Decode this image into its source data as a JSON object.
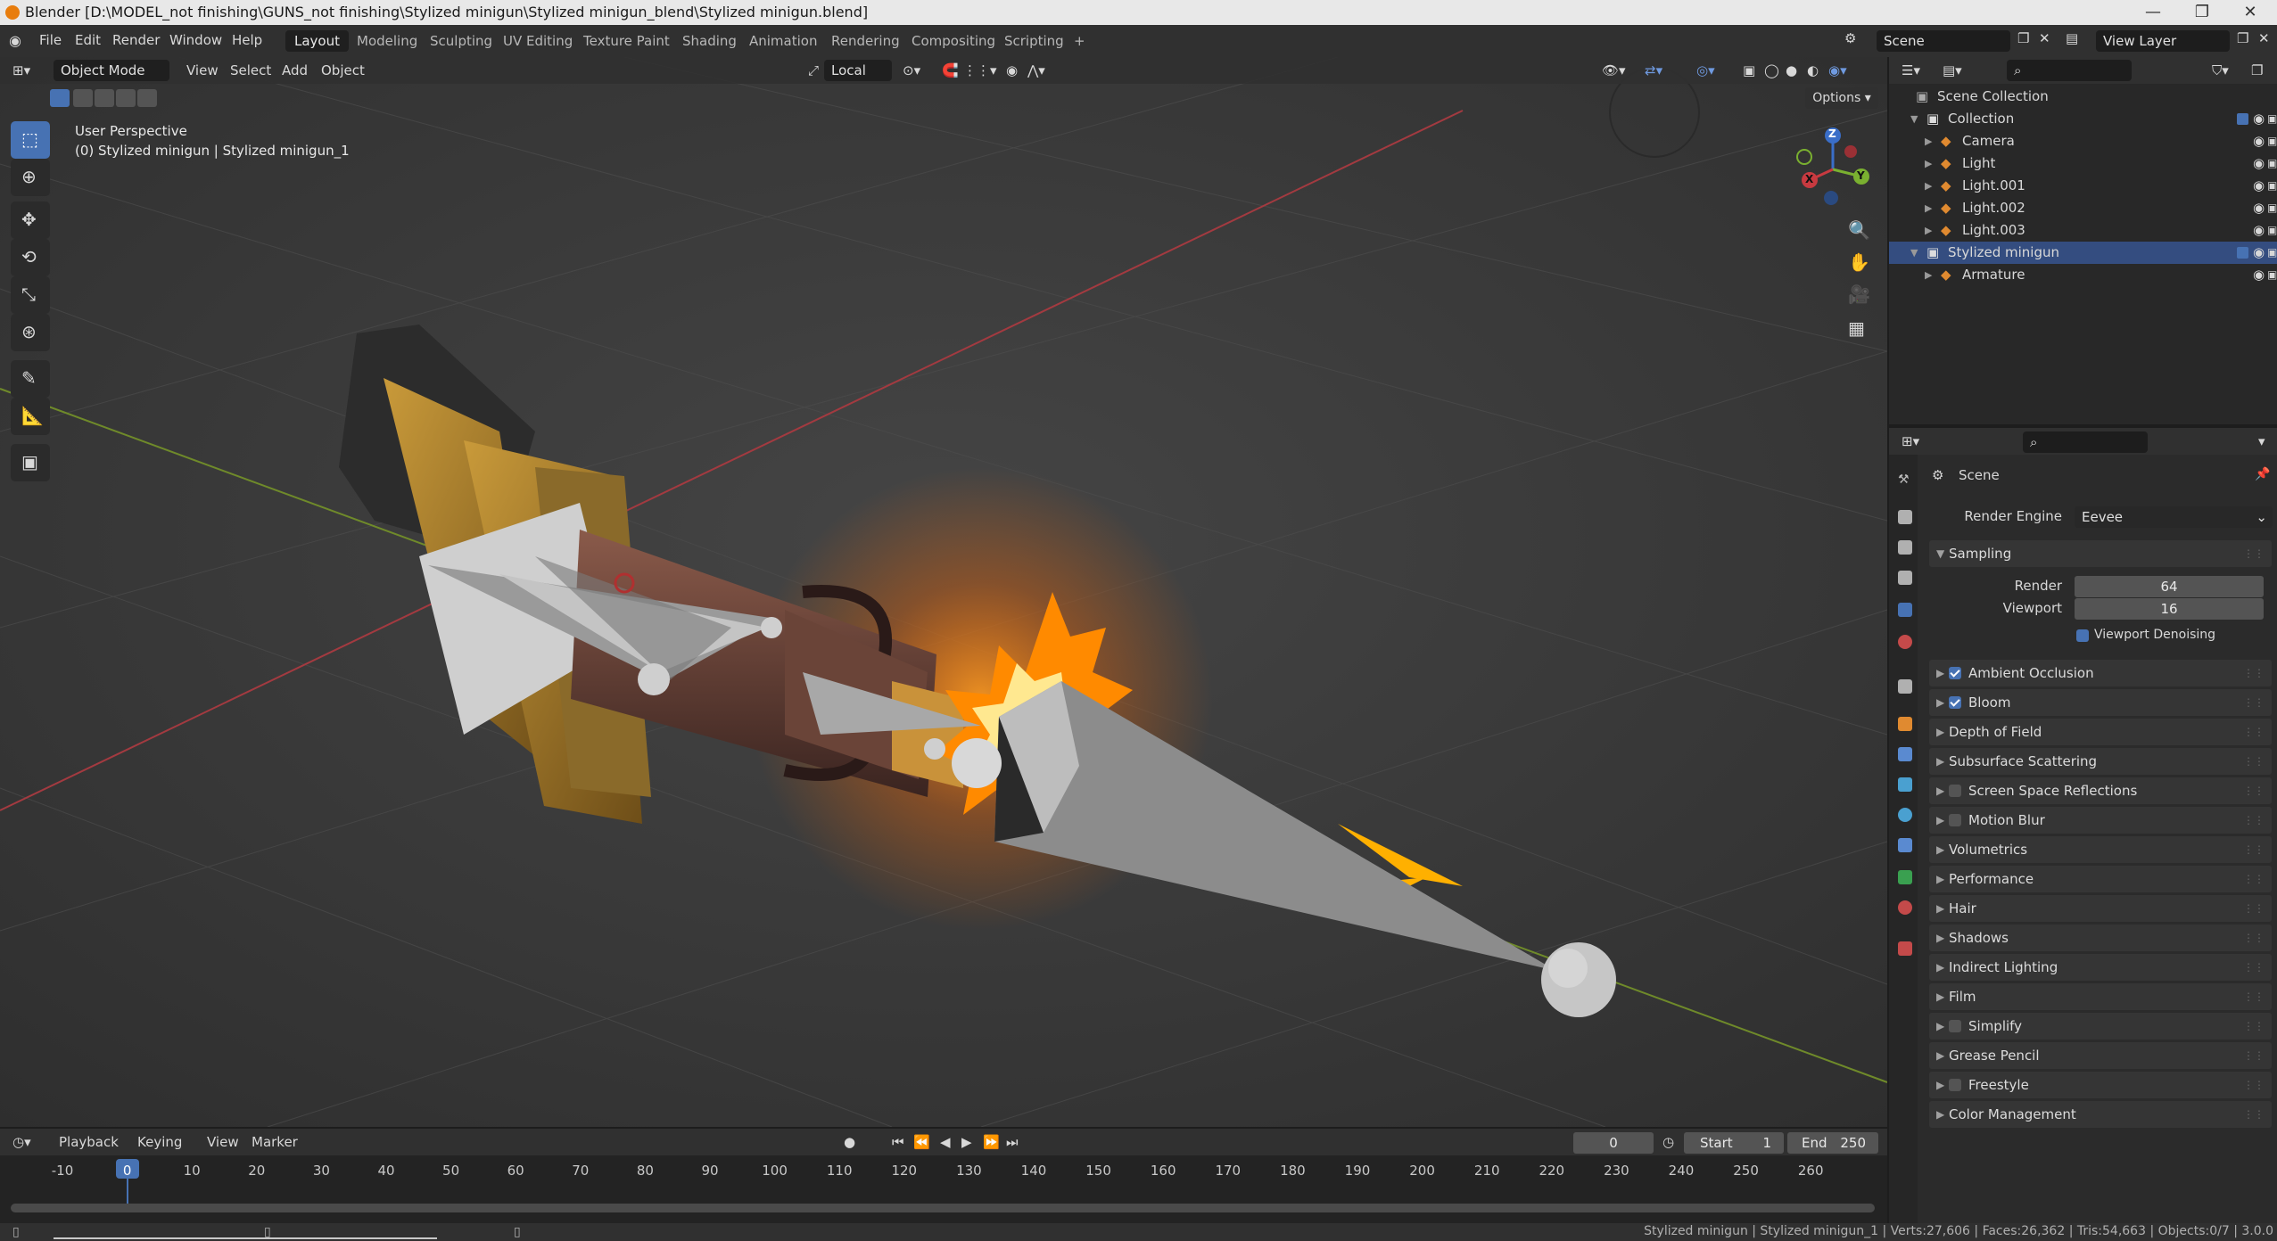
{
  "window": {
    "title": "Blender [D:\\MODEL_not finishing\\GUNS_not finishing\\Stylized minigun\\Stylized minigun_blend\\Stylized minigun.blend]"
  },
  "menus": [
    "File",
    "Edit",
    "Render",
    "Window",
    "Help"
  ],
  "workspaces": [
    "Layout",
    "Modeling",
    "Sculpting",
    "UV Editing",
    "Texture Paint",
    "Shading",
    "Animation",
    "Rendering",
    "Compositing",
    "Scripting",
    "+"
  ],
  "scene": {
    "name": "Scene",
    "view_layer": "View Layer"
  },
  "viewport_header": {
    "mode": "Object Mode",
    "menus": [
      "View",
      "Select",
      "Add",
      "Object"
    ],
    "transform_orientation": "Local",
    "options_label": "Options"
  },
  "viewport_overlay": {
    "perspective": "User Perspective",
    "object_info": "(0) Stylized minigun | Stylized minigun_1"
  },
  "gizmo": {
    "x": "X",
    "y": "Y",
    "z": "Z"
  },
  "outliner": {
    "root": "Scene Collection",
    "rows": [
      {
        "label": "Collection",
        "level": 0,
        "type": "collection"
      },
      {
        "label": "Camera",
        "level": 1,
        "type": "object"
      },
      {
        "label": "Light",
        "level": 1,
        "type": "object"
      },
      {
        "label": "Light.001",
        "level": 1,
        "type": "object"
      },
      {
        "label": "Light.002",
        "level": 1,
        "type": "object"
      },
      {
        "label": "Light.003",
        "level": 1,
        "type": "object"
      },
      {
        "label": "Stylized minigun",
        "level": 0,
        "type": "collection",
        "selected": true
      },
      {
        "label": "Armature",
        "level": 1,
        "type": "object"
      }
    ]
  },
  "properties": {
    "context": "Scene",
    "render_engine_label": "Render Engine",
    "render_engine": "Eevee",
    "sampling": {
      "label": "Sampling",
      "render_label": "Render",
      "render": "64",
      "viewport_label": "Viewport",
      "viewport": "16",
      "denoise_label": "Viewport Denoising"
    },
    "panels": [
      {
        "label": "Ambient Occlusion",
        "checkbox": true,
        "checked": true
      },
      {
        "label": "Bloom",
        "checkbox": true,
        "checked": true
      },
      {
        "label": "Depth of Field",
        "checkbox": false
      },
      {
        "label": "Subsurface Scattering",
        "checkbox": false
      },
      {
        "label": "Screen Space Reflections",
        "checkbox": true,
        "checked": false
      },
      {
        "label": "Motion Blur",
        "checkbox": true,
        "checked": false
      },
      {
        "label": "Volumetrics",
        "checkbox": false
      },
      {
        "label": "Performance",
        "checkbox": false
      },
      {
        "label": "Hair",
        "checkbox": false
      },
      {
        "label": "Shadows",
        "checkbox": false
      },
      {
        "label": "Indirect Lighting",
        "checkbox": false
      },
      {
        "label": "Film",
        "checkbox": false
      },
      {
        "label": "Simplify",
        "checkbox": true,
        "checked": false
      },
      {
        "label": "Grease Pencil",
        "checkbox": false
      },
      {
        "label": "Freestyle",
        "checkbox": true,
        "checked": false
      },
      {
        "label": "Color Management",
        "checkbox": false
      }
    ]
  },
  "timeline": {
    "menus": [
      "Playback",
      "Keying",
      "View",
      "Marker"
    ],
    "current_frame": "0",
    "start_label": "Start",
    "start": "1",
    "end_label": "End",
    "end": "250",
    "ticks": [
      "-10",
      "0",
      "10",
      "20",
      "30",
      "40",
      "50",
      "60",
      "70",
      "80",
      "90",
      "100",
      "110",
      "120",
      "130",
      "140",
      "150",
      "160",
      "170",
      "180",
      "190",
      "200",
      "210",
      "220",
      "230",
      "240",
      "250",
      "260"
    ]
  },
  "status": {
    "text": "Stylized minigun | Stylized minigun_1 | Verts:27,606 | Faces:26,362 | Tris:54,663 | Objects:0/7 | 3.0.0"
  },
  "colors": {
    "accent": "#4772b3",
    "selected_row": "#344d80",
    "flash_orange": "#ff8a00",
    "flash_core": "#fff0b0"
  }
}
